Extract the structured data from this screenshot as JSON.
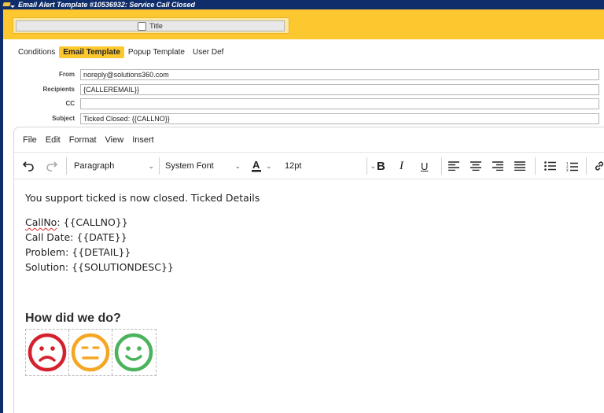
{
  "window": {
    "title": "Email Alert Template #10536932: Service Call Closed"
  },
  "header": {
    "title_field_label": "Title"
  },
  "tabs": [
    {
      "label": "Conditions",
      "active": false
    },
    {
      "label": "Email Template",
      "active": true
    },
    {
      "label": "Popup Template",
      "active": false
    },
    {
      "label": "User Def",
      "active": false
    }
  ],
  "form": {
    "from": {
      "label": "From",
      "value": "noreply@solutions360.com"
    },
    "recipients": {
      "label": "Recipients",
      "value": "{CALLEREMAIL}}"
    },
    "cc": {
      "label": "CC",
      "value": ""
    },
    "subject": {
      "label": "Subject",
      "value": "Ticked Closed: {{CALLNO}}"
    }
  },
  "editor": {
    "menu": [
      "File",
      "Edit",
      "Format",
      "View",
      "Insert"
    ],
    "toolbar": {
      "block_format": "Paragraph",
      "font_family": "System Font",
      "font_size": "12pt"
    },
    "body": {
      "intro": "You support ticked is now closed.  Ticked Details",
      "callno_word": "CallNo",
      "callno_rest": ": {{CALLNO}}",
      "call_date": "Call Date: {{DATE}}",
      "problem": "Problem: {{DETAIL}}",
      "solution": "Solution: {{SOLUTIONDESC}}",
      "survey_heading": "How did we do?"
    }
  },
  "colors": {
    "titlebar": "#0f2d6b",
    "accent": "#fcc72f",
    "face_sad": "#d5202e",
    "face_neutral": "#f5a623",
    "face_happy": "#4ab35c"
  },
  "icons": [
    "undo-icon",
    "redo-icon",
    "text-color-icon",
    "bold-icon",
    "italic-icon",
    "underline-icon",
    "align-left-icon",
    "align-center-icon",
    "align-right-icon",
    "align-justify-icon",
    "bullet-list-icon",
    "numbered-list-icon",
    "link-icon",
    "sad-face-icon",
    "neutral-face-icon",
    "happy-face-icon"
  ]
}
